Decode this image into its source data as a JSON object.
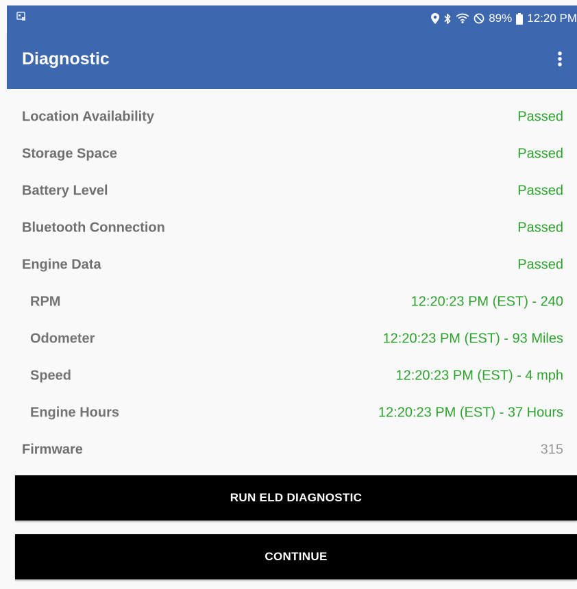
{
  "status_bar": {
    "notification_icon": "app-notification-icon",
    "icons": [
      "location-icon",
      "bluetooth-icon",
      "wifi-icon",
      "do-not-disturb-icon",
      "battery-icon"
    ],
    "battery": "89%",
    "time": "12:20 PM"
  },
  "app_bar": {
    "title": "Diagnostic",
    "menu_icon": "more-vert-icon"
  },
  "colors": {
    "app_bar": "#3d67ae",
    "passed": "#2ea22e",
    "button": "#000000"
  },
  "diagnostics": [
    {
      "label": "Location Availability",
      "value": "Passed"
    },
    {
      "label": "Storage Space",
      "value": "Passed"
    },
    {
      "label": "Battery Level",
      "value": "Passed"
    },
    {
      "label": "Bluetooth Connection",
      "value": "Passed"
    },
    {
      "label": "Engine Data",
      "value": "Passed"
    },
    {
      "label": "RPM",
      "value": "12:20:23 PM (EST) - 240"
    },
    {
      "label": "Odometer",
      "value": "12:20:23 PM (EST) - 93 Miles"
    },
    {
      "label": "Speed",
      "value": "12:20:23 PM (EST) - 4 mph"
    },
    {
      "label": "Engine Hours",
      "value": "12:20:23 PM (EST) - 37 Hours"
    },
    {
      "label": "Firmware",
      "value": "315"
    }
  ],
  "buttons": {
    "run_diagnostic": "RUN ELD DIAGNOSTIC",
    "continue": "CONTINUE"
  }
}
